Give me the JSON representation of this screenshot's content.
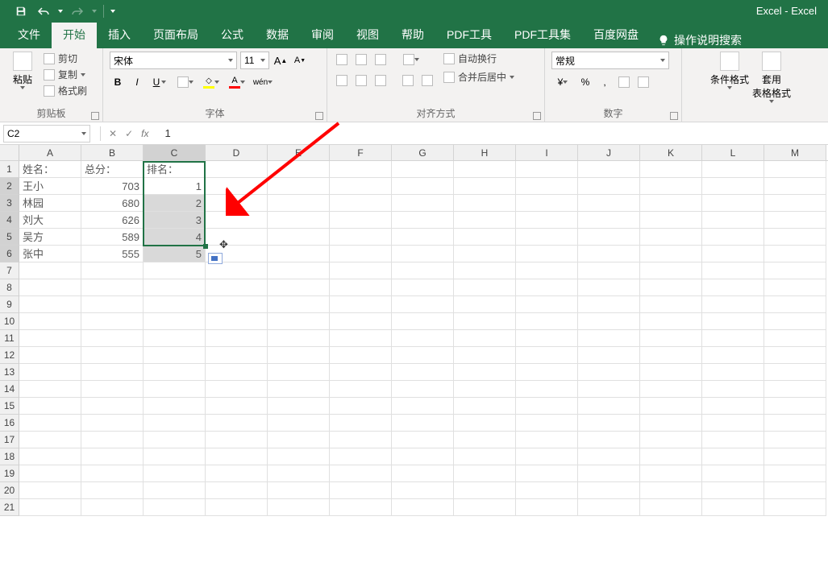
{
  "app": {
    "title": "Excel - Excel"
  },
  "qat": {
    "save": "save-icon",
    "undo": "undo-icon",
    "redo": "redo-icon"
  },
  "tabs": {
    "file": "文件",
    "home": "开始",
    "insert": "插入",
    "layout": "页面布局",
    "formulas": "公式",
    "data": "数据",
    "review": "审阅",
    "view": "视图",
    "help": "帮助",
    "pdftool": "PDF工具",
    "pdftoolset": "PDF工具集",
    "baidu": "百度网盘",
    "tellme": "操作说明搜索"
  },
  "ribbon": {
    "clipboard": {
      "cut": "剪切",
      "copy": "复制",
      "painter": "格式刷",
      "paste": "粘贴",
      "label": "剪贴板"
    },
    "font": {
      "name": "宋体",
      "size": "11",
      "label": "字体"
    },
    "alignment": {
      "wrap": "自动换行",
      "merge": "合并后居中",
      "label": "对齐方式"
    },
    "number": {
      "format": "常规",
      "label": "数字"
    },
    "styles": {
      "condfmt": "条件格式",
      "tablefmt": "套用\n表格格式"
    }
  },
  "namebox": {
    "ref": "C2"
  },
  "formula": {
    "value": "1"
  },
  "columns": [
    "A",
    "B",
    "C",
    "D",
    "E",
    "F",
    "G",
    "H",
    "I",
    "J",
    "K",
    "L",
    "M"
  ],
  "rows": [
    {
      "n": "1",
      "A": "姓名：",
      "B": "总分：",
      "C": "排名："
    },
    {
      "n": "2",
      "A": "王小",
      "B": "703",
      "C": "1"
    },
    {
      "n": "3",
      "A": "林园",
      "B": "680",
      "C": "2"
    },
    {
      "n": "4",
      "A": "刘大",
      "B": "626",
      "C": "3"
    },
    {
      "n": "5",
      "A": "吴方",
      "B": "589",
      "C": "4"
    },
    {
      "n": "6",
      "A": "张中",
      "B": "555",
      "C": "5"
    },
    {
      "n": "7"
    },
    {
      "n": "8"
    },
    {
      "n": "9"
    },
    {
      "n": "10"
    },
    {
      "n": "11"
    },
    {
      "n": "12"
    },
    {
      "n": "13"
    },
    {
      "n": "14"
    },
    {
      "n": "15"
    },
    {
      "n": "16"
    },
    {
      "n": "17"
    },
    {
      "n": "18"
    },
    {
      "n": "19"
    },
    {
      "n": "20"
    },
    {
      "n": "21"
    }
  ],
  "selection": {
    "activeCell": "C2",
    "range": "C2:C6"
  }
}
